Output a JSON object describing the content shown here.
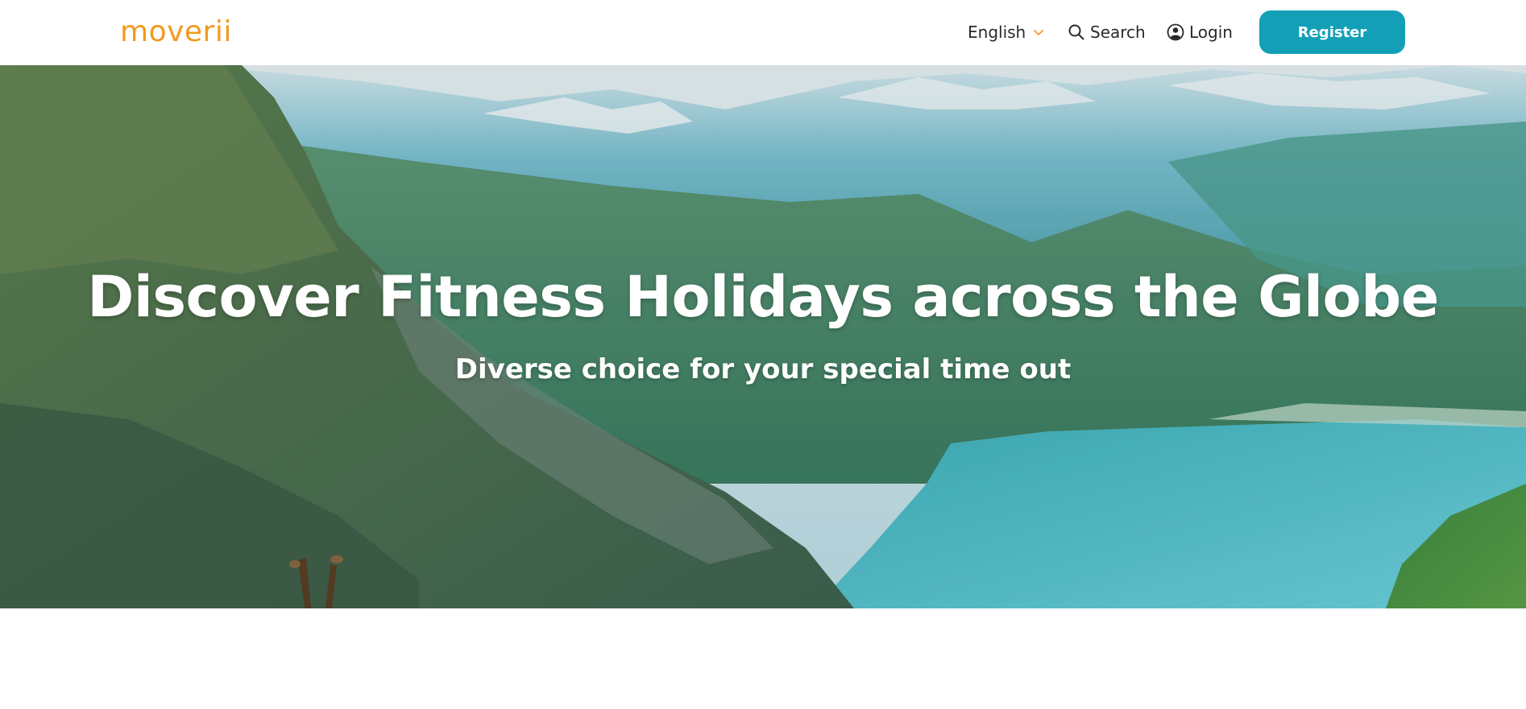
{
  "header": {
    "logo": "moverii",
    "language": "English",
    "search_label": "Search",
    "login_label": "Login",
    "register_label": "Register"
  },
  "hero": {
    "title": "Discover Fitness Holidays across the Globe",
    "subtitle": "Diverse choice for your special time out"
  },
  "colors": {
    "brand_orange": "#f29a1f",
    "accent_teal": "#13a0b7"
  },
  "icons": {
    "language_chevron": "chevron-down-icon",
    "search": "search-icon",
    "login": "user-circle-icon"
  }
}
